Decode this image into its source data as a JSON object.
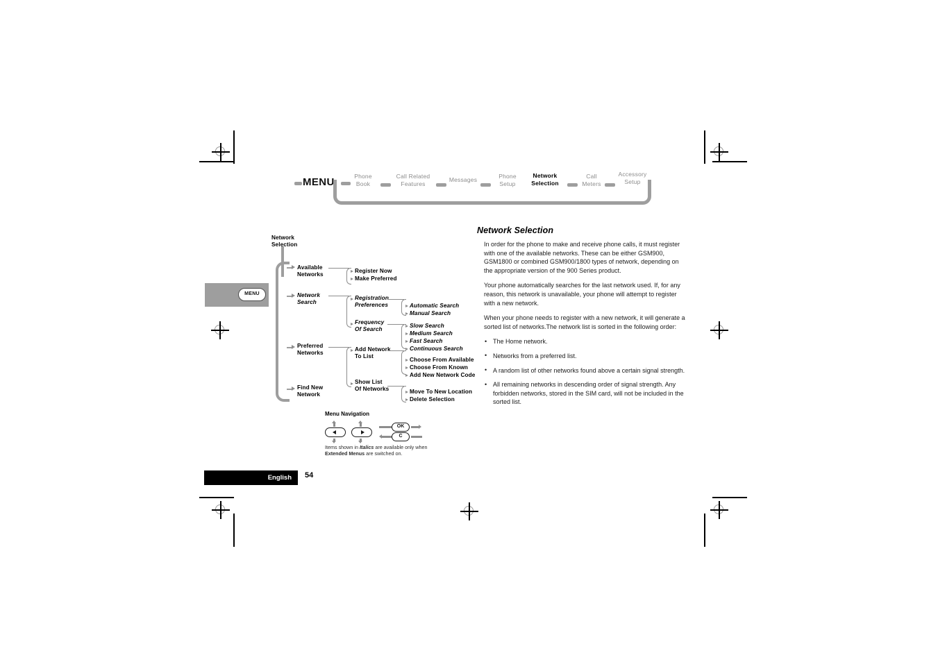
{
  "nav": {
    "menu_label": "MENU",
    "items": [
      {
        "line1": "Phone",
        "line2": "Book",
        "current": false
      },
      {
        "line1": "Call Related",
        "line2": "Features",
        "current": false
      },
      {
        "line1": "Messages",
        "line2": "",
        "current": false
      },
      {
        "line1": "Phone",
        "line2": "Setup",
        "current": false
      },
      {
        "line1": "Network",
        "line2": "Selection",
        "current": true
      },
      {
        "line1": "Call",
        "line2": "Meters",
        "current": false
      },
      {
        "line1": "Accessory",
        "line2": "Setup",
        "current": false
      }
    ]
  },
  "menu_tab": {
    "label": "MENU"
  },
  "tree": {
    "root": {
      "line1": "Network",
      "line2": "Selection"
    },
    "nodes": {
      "available_networks": {
        "line1": "Available",
        "line2": "Networks",
        "italic": false
      },
      "register_now": {
        "line1": "Register Now",
        "italic": false
      },
      "make_preferred": {
        "line1": "Make Preferred",
        "italic": false
      },
      "network_search": {
        "line1": "Network",
        "line2": "Search",
        "italic": true
      },
      "registration_prefs": {
        "line1": "Registration",
        "line2": "Preferences",
        "italic": true
      },
      "automatic_search": {
        "line1": "Automatic Search",
        "italic": true
      },
      "manual_search": {
        "line1": "Manual Search",
        "italic": true
      },
      "frequency_of_search": {
        "line1": "Frequency",
        "line2": "Of Search",
        "italic": true
      },
      "slow_search": {
        "line1": "Slow Search",
        "italic": true
      },
      "medium_search": {
        "line1": "Medium Search",
        "italic": true
      },
      "fast_search": {
        "line1": "Fast Search",
        "italic": true
      },
      "continuous_search": {
        "line1": "Continuous Search",
        "italic": true
      },
      "preferred_networks": {
        "line1": "Preferred",
        "line2": "Networks",
        "italic": false
      },
      "add_network_to_list": {
        "line1": "Add Network",
        "line2": "To List",
        "italic": false
      },
      "choose_from_available": {
        "line1": "Choose From Available",
        "italic": false
      },
      "choose_from_known": {
        "line1": "Choose From Known",
        "italic": false
      },
      "add_new_network_code": {
        "line1": "Add New Network Code",
        "italic": false
      },
      "show_list_of_networks": {
        "line1": "Show List",
        "line2": "Of Networks",
        "italic": false
      },
      "move_to_new_location": {
        "line1": "Move To New Location",
        "italic": false
      },
      "delete_selection": {
        "line1": "Delete Selection",
        "italic": false
      },
      "find_new_network": {
        "line1": "Find New",
        "line2": "Network",
        "italic": false
      }
    }
  },
  "legend": {
    "title": "Menu Navigation",
    "ok_key": "OK",
    "c_key": "C",
    "note_part1": "Items shown in ",
    "note_italic": "Italics",
    "note_part2": " are available only when ",
    "note_bold": "Extended Menus",
    "note_part3": " are switched on."
  },
  "content": {
    "title": "Network Selection",
    "paragraphs": [
      "In order for the phone to make and receive phone calls, it must register with one of the available networks. These can be either GSM900, GSM1800 or combined GSM900/1800 types of network, depending on the appropriate version of the 900 Series product.",
      "Your phone automatically searches for the last network used. If, for any reason, this network is unavailable, your phone will attempt to register with a new network.",
      "When your phone needs to register with a new network, it will generate a sorted list of networks.The network list is sorted in the following order:"
    ],
    "bullets": [
      "The Home network.",
      "Networks from a preferred list.",
      "A random list of other networks found above a certain signal strength.",
      "All remaining networks in descending order of signal strength. Any forbidden networks, stored in the SIM card, will not be included in the sorted list."
    ]
  },
  "footer": {
    "language": "English",
    "page_number": "54"
  }
}
